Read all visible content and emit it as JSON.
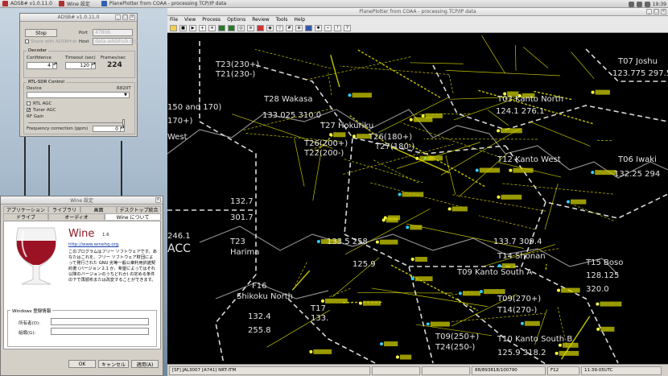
{
  "taskbar": {
    "tasks": [
      "ADSB# v1.0.11.0",
      "Wine 設定",
      "PlanePlotter from COAA - processing TCP/IP data"
    ],
    "clock": "19:39"
  },
  "adsb": {
    "title": "ADSB# v1.0.11.0",
    "stop": "Stop",
    "port_label": "Port",
    "port_value": "47806",
    "share_label": "Share with ADSBHub",
    "host_label": "Host",
    "host_value": "data.adsbhub.org",
    "decoder_label": "Decoder",
    "confidence_label": "Confidence",
    "confidence_value": "4",
    "timeout_label": "Timeout (sec)",
    "timeout_value": "120",
    "fps_label": "Frames/sec",
    "fps_value": "224",
    "rtl_label": "RTL-SDR Control",
    "device_label": "Device",
    "device_value": "R820T",
    "rtl_agc": "RTL AGC",
    "tuner_agc": "Tuner AGC",
    "rf_gain": "RF Gain",
    "freq_corr_label": "Frequency correction (ppm)",
    "freq_corr_value": "0",
    "tuner_agc_checked": "✔"
  },
  "wine": {
    "title": "Wine 設定",
    "tabs_row1": [
      "アプリケーション",
      "ライブラリ",
      "画面",
      "デスクトップ統合"
    ],
    "tabs_row2": [
      "ドライブ",
      "オーディオ",
      "Wine について"
    ],
    "app_name": "Wine",
    "version": "1.6",
    "url": "http://www.winehq.org",
    "license": "このプログラムはフリー ソフトウェアです。あなたはこれを、フリー ソフトウェア財団によって発行された GNU 劣等一般公衆利用許諾契約書 (バージョン 2.1 か、希望によってはそれ以降のバージョンのうちどれか) の定める条件の下で再頒布または改変することができます。",
    "reg_label": "Windows 登録情報",
    "owner_label": "所有者(O):",
    "org_label": "組織(G):",
    "ok": "OK",
    "cancel": "キャンセル",
    "apply": "適用(A)"
  },
  "pp": {
    "title": "PlanePlotter from COAA - processing TCP/IP data",
    "menu": [
      "File",
      "View",
      "Process",
      "Options",
      "Review",
      "Tools",
      "Help"
    ],
    "status": [
      "[SF] JAL3007 [A741] NRT-ITM",
      "",
      "",
      "88/893818/100790",
      "F12",
      "11:39:05UTC"
    ]
  },
  "map_labels": [
    {
      "text": "T23(230+)",
      "cls": "big"
    },
    {
      "text": "T21(230-)",
      "cls": "big"
    },
    {
      "text": "T28   Wakasa",
      "cls": "big"
    },
    {
      "text": "133.025 310.0",
      "cls": "big"
    },
    {
      "text": "T27   Hokuriku",
      "cls": "big"
    },
    {
      "text": "T26(200+)",
      "cls": "big"
    },
    {
      "text": "T22(200-)",
      "cls": "big"
    },
    {
      "text": "T26(180+)",
      "cls": "big"
    },
    {
      "text": "T27(180-)",
      "cls": "big"
    },
    {
      "text": "T07   Joshu",
      "cls": "big"
    },
    {
      "text": "123.775 297.5",
      "cls": "big"
    },
    {
      "text": "T03   Kanto North",
      "cls": "big"
    },
    {
      "text": "124.1  276.1",
      "cls": "big"
    },
    {
      "text": "T12   Kanto West",
      "cls": "big"
    },
    {
      "text": "T06   Iwaki",
      "cls": "big"
    },
    {
      "text": "132.25 294",
      "cls": "big"
    },
    {
      "text": "150 and 170)",
      "cls": "big"
    },
    {
      "text": "170+)",
      "cls": "big"
    },
    {
      "text": "West",
      "cls": "big"
    },
    {
      "text": "132.7",
      "cls": "big"
    },
    {
      "text": "301.7",
      "cls": "big"
    },
    {
      "text": "246.1",
      "cls": "big"
    },
    {
      "text": "ACC",
      "cls": "big2"
    },
    {
      "text": "T23",
      "cls": "big"
    },
    {
      "text": "Harima",
      "cls": "big"
    },
    {
      "text": "133.5 258",
      "cls": "big"
    },
    {
      "text": "125.9",
      "cls": "big"
    },
    {
      "text": "F16",
      "cls": "big"
    },
    {
      "text": "Shikoku North",
      "cls": "big"
    },
    {
      "text": "132.4",
      "cls": "big"
    },
    {
      "text": "255.8",
      "cls": "big"
    },
    {
      "text": "T17",
      "cls": "big"
    },
    {
      "text": "133.",
      "cls": "big"
    },
    {
      "text": "T09   Kanto South A",
      "cls": "big"
    },
    {
      "text": "T14   Shonan",
      "cls": "big"
    },
    {
      "text": "133.7 309.4",
      "cls": "big"
    },
    {
      "text": "T15   Boso",
      "cls": "big"
    },
    {
      "text": "128.125",
      "cls": "big"
    },
    {
      "text": "320.0",
      "cls": "big"
    },
    {
      "text": "T09(270+)",
      "cls": "big"
    },
    {
      "text": "T14(270-)",
      "cls": "big"
    },
    {
      "text": "T09(250+)",
      "cls": "big"
    },
    {
      "text": "T24(250-)",
      "cls": "big"
    },
    {
      "text": "T10   Kanto South B",
      "cls": "big"
    },
    {
      "text": "125.9  318.2",
      "cls": "big"
    }
  ]
}
